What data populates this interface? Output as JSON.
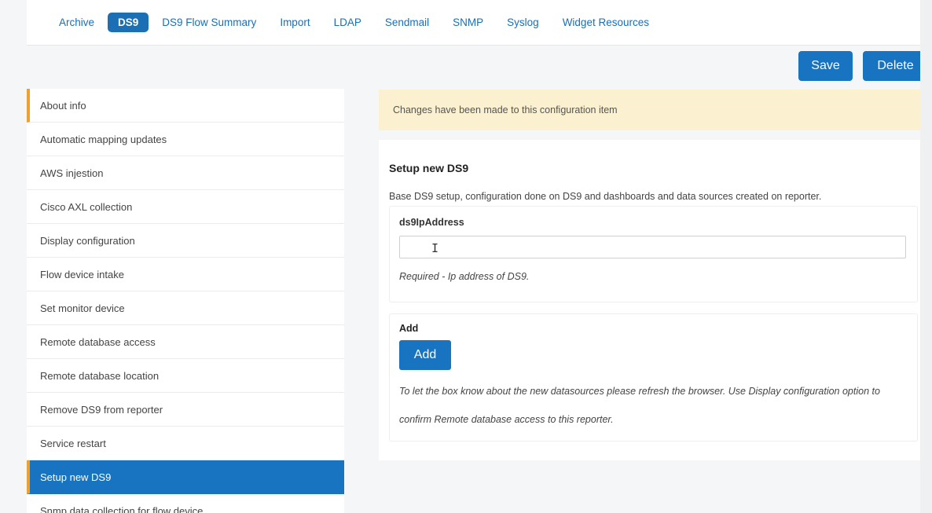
{
  "tabs": [
    {
      "label": "Archive",
      "active": false
    },
    {
      "label": "DS9",
      "active": true
    },
    {
      "label": "DS9 Flow Summary",
      "active": false
    },
    {
      "label": "Import",
      "active": false
    },
    {
      "label": "LDAP",
      "active": false
    },
    {
      "label": "Sendmail",
      "active": false
    },
    {
      "label": "SNMP",
      "active": false
    },
    {
      "label": "Syslog",
      "active": false
    },
    {
      "label": "Widget Resources",
      "active": false
    }
  ],
  "actions": {
    "save_label": "Save",
    "delete_label": "Delete"
  },
  "sidebar": {
    "items": [
      "About info",
      "Automatic mapping updates",
      "AWS injestion",
      "Cisco AXL collection",
      "Display configuration",
      "Flow device intake",
      "Set monitor device",
      "Remote database access",
      "Remote database location",
      "Remove DS9 from reporter",
      "Service restart",
      "Setup new DS9",
      "Snmp data collection for flow device"
    ],
    "active_index": 11
  },
  "notice": {
    "text": "Changes have been made to this configuration item"
  },
  "panel": {
    "title": "Setup new DS9",
    "description": "Base DS9 setup, configuration done on DS9 and dashboards and data sources created on reporter.",
    "field": {
      "label": "ds9IpAddress",
      "value": "",
      "placeholder": "",
      "help": "Required - Ip address of DS9."
    },
    "add": {
      "label": "Add",
      "button_label": "Add",
      "help": "To let the box know about the new datasources please refresh the browser. Use Display configuration option to confirm Remote database access to this reporter."
    }
  },
  "colors": {
    "accent": "#1873c0",
    "sidebar_marker": "#f0a030",
    "notice_bg": "#fbf0cf"
  }
}
